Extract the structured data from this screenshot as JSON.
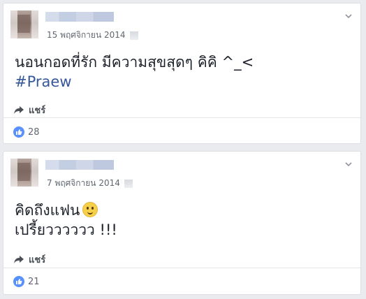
{
  "colors": {
    "page_background": "#e9ebee",
    "card_background": "#ffffff",
    "hashtag": "#365899",
    "like_badge": "#5890ff",
    "secondary_text": "#616770"
  },
  "posts": [
    {
      "date": "15 พฤศจิกายน 2014",
      "text_line1": "นอนกอดที่รัก มีความสุขสุดๆ คิคิ ^_<",
      "hashtag": "#Praew",
      "share_label": "แชร์",
      "like_count": "28",
      "icons": [
        "avatar",
        "privacy-icon",
        "chevron-down-icon",
        "share-arrow-icon",
        "like-icon"
      ]
    },
    {
      "date": "7 พฤศจิกายน 2014",
      "text_line1": "คิดถึงแฟน",
      "text_line2": "เปรี้ยวววววว !!!",
      "share_label": "แชร์",
      "like_count": "21",
      "icons": [
        "avatar",
        "privacy-icon",
        "chevron-down-icon",
        "smile-emoji-icon",
        "share-arrow-icon",
        "like-icon"
      ]
    }
  ]
}
